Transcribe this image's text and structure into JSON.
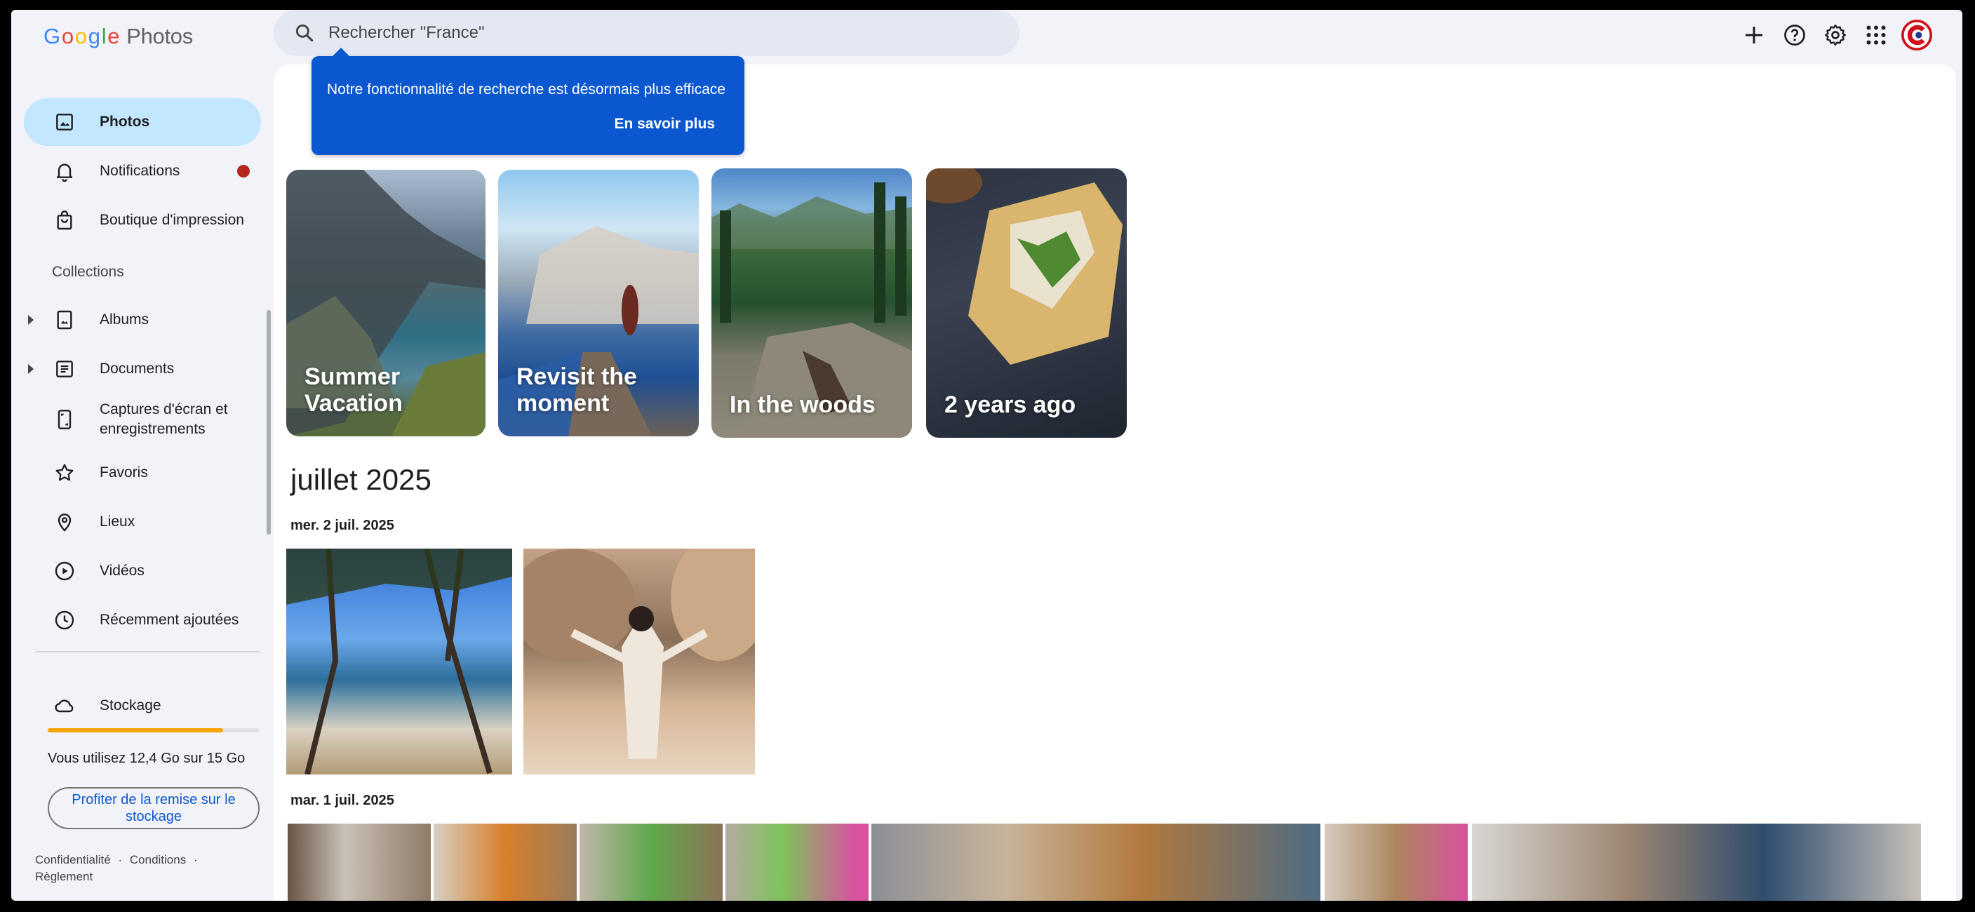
{
  "app": {
    "logo_google": [
      "G",
      "o",
      "o",
      "g",
      "l",
      "e"
    ],
    "logo_product": "Photos"
  },
  "search": {
    "placeholder": "Rechercher \"France\""
  },
  "tooltip": {
    "text": "Notre fonctionnalité de recherche est désormais plus efficace",
    "link": "En savoir plus"
  },
  "top_icons": [
    "add-icon",
    "help-icon",
    "settings-icon",
    "apps-icon",
    "account-avatar"
  ],
  "sidebar": {
    "items": [
      {
        "label": "Photos",
        "icon": "photo-icon",
        "active": true
      },
      {
        "label": "Notifications",
        "icon": "bell-icon",
        "badge": true
      },
      {
        "label": "Boutique d'impression",
        "icon": "shopping-bag-icon"
      }
    ],
    "collections_title": "Collections",
    "collections": [
      {
        "label": "Albums",
        "icon": "album-icon",
        "expandable": true
      },
      {
        "label": "Documents",
        "icon": "document-icon",
        "expandable": true
      },
      {
        "label": "Captures d'écran et enregistrements",
        "icon": "phone-screenshot-icon"
      },
      {
        "label": "Favoris",
        "icon": "star-icon"
      },
      {
        "label": "Lieux",
        "icon": "location-pin-icon"
      },
      {
        "label": "Vidéos",
        "icon": "play-circle-icon"
      },
      {
        "label": "Récemment ajoutées",
        "icon": "clock-icon"
      }
    ],
    "storage": {
      "label": "Stockage",
      "usage_text": "Vous utilisez 12,4 Go sur 15 Go",
      "used_fraction": 0.827,
      "button": "Profiter de la remise sur le stockage"
    },
    "footer": {
      "privacy": "Confidentialité",
      "sep1": "·",
      "terms": "Conditions",
      "sep2": "·",
      "policy": "Règlement"
    }
  },
  "memories": [
    {
      "label": "Summer Vacation"
    },
    {
      "label": "Revisit the moment"
    },
    {
      "label": "In the woods"
    },
    {
      "label": "2 years ago"
    }
  ],
  "timeline": {
    "month": "juillet 2025",
    "groups": [
      {
        "date": "mer. 2 juil. 2025",
        "photo_count": 2
      },
      {
        "date": "mar. 1 juil. 2025",
        "photo_count": 7
      }
    ]
  },
  "colors": {
    "accent_blue": "#0b57d0",
    "active_nav": "#c2e7ff",
    "notification_dot": "#b3261e",
    "storage_fill": "#f5a300"
  }
}
